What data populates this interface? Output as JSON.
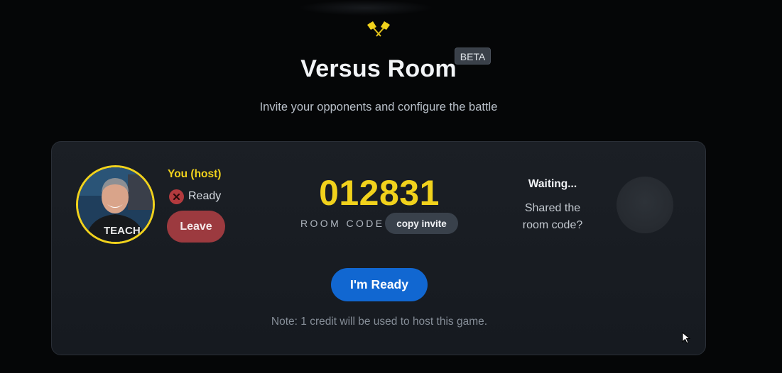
{
  "header": {
    "title": "Versus Room",
    "badge": "BETA",
    "subtitle": "Invite your opponents and configure the battle",
    "logo_icon": "crossed-flags-icon"
  },
  "host": {
    "label": "You (host)",
    "status_text": "Ready",
    "status_icon": "x-circle-icon",
    "leave_label": "Leave",
    "avatar_shirt_text": "TEACH"
  },
  "room": {
    "code": "012831",
    "code_label": "ROOM CODE",
    "copy_label": "copy invite"
  },
  "opponent": {
    "status": "Waiting...",
    "prompt": "Shared the room code?"
  },
  "actions": {
    "ready_label": "I'm Ready",
    "note": "Note: 1 credit will be used to host this game."
  },
  "colors": {
    "accent_yellow": "#f1d21c",
    "leave_red": "#9c3a3f",
    "ready_blue": "#1167d1",
    "background": "#050607",
    "card": "#1b1f25"
  }
}
